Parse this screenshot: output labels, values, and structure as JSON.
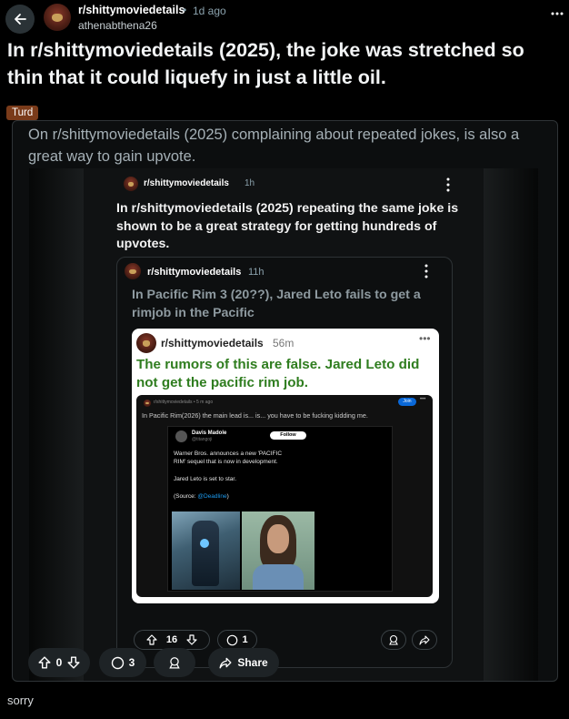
{
  "header": {
    "subreddit": "r/shittymoviedetails",
    "age": "1d ago",
    "username": "athenabthena26",
    "menu_icon": "ellipsis-icon"
  },
  "post": {
    "title": "In r/shittymoviedetails (2025), the joke was stretched so thin that it could liquefy in just a little oil.",
    "flair": "Turd",
    "flair_color": "#7a3b1a"
  },
  "embedded": {
    "text": "On r/shittymoviedetails (2025) complaining about repeated jokes, is also a great way to gain upvote.",
    "level1": {
      "subreddit": "r/shittymoviedetails",
      "age": "1h",
      "title": "In r/shittymoviedetails (2025) repeating the same joke is shown to be a great strategy for getting hundreds of upvotes."
    },
    "level2": {
      "subreddit": "r/shittymoviedetails",
      "age": "11h",
      "title": "In Pacific Rim 3 (20??), Jared Leto fails to get a rimjob in the Pacific",
      "votes": "16",
      "comments": "1"
    },
    "level3": {
      "subreddit": "r/shittymoviedetails",
      "age": "56m",
      "title": "The rumors of this are false. Jared Leto did not get the pacific rim job.",
      "title_color": "#2f7d1f"
    },
    "level4": {
      "meta": "r/shittymoviedetails • 5 m ago",
      "join": "Join",
      "title": "In Pacific Rim(2026) the main lead is... is... you have to be fucking kidding me.",
      "tweet_name": "Davis Madole",
      "tweet_handle": "@titangoji",
      "follow": "Follow",
      "tweet_line1": "Warner Bros. announces a new 'PACIFIC",
      "tweet_line2": "RIM' sequel that is now in development.",
      "tweet_line3": "Jared Leto is set to star.",
      "tweet_source_prefix": "(Source: ",
      "tweet_source_link": "@Deadline",
      "tweet_source_suffix": ")"
    }
  },
  "actions": {
    "votes": "0",
    "comments": "3",
    "share": "Share"
  },
  "footer": {
    "text": "sorry"
  }
}
